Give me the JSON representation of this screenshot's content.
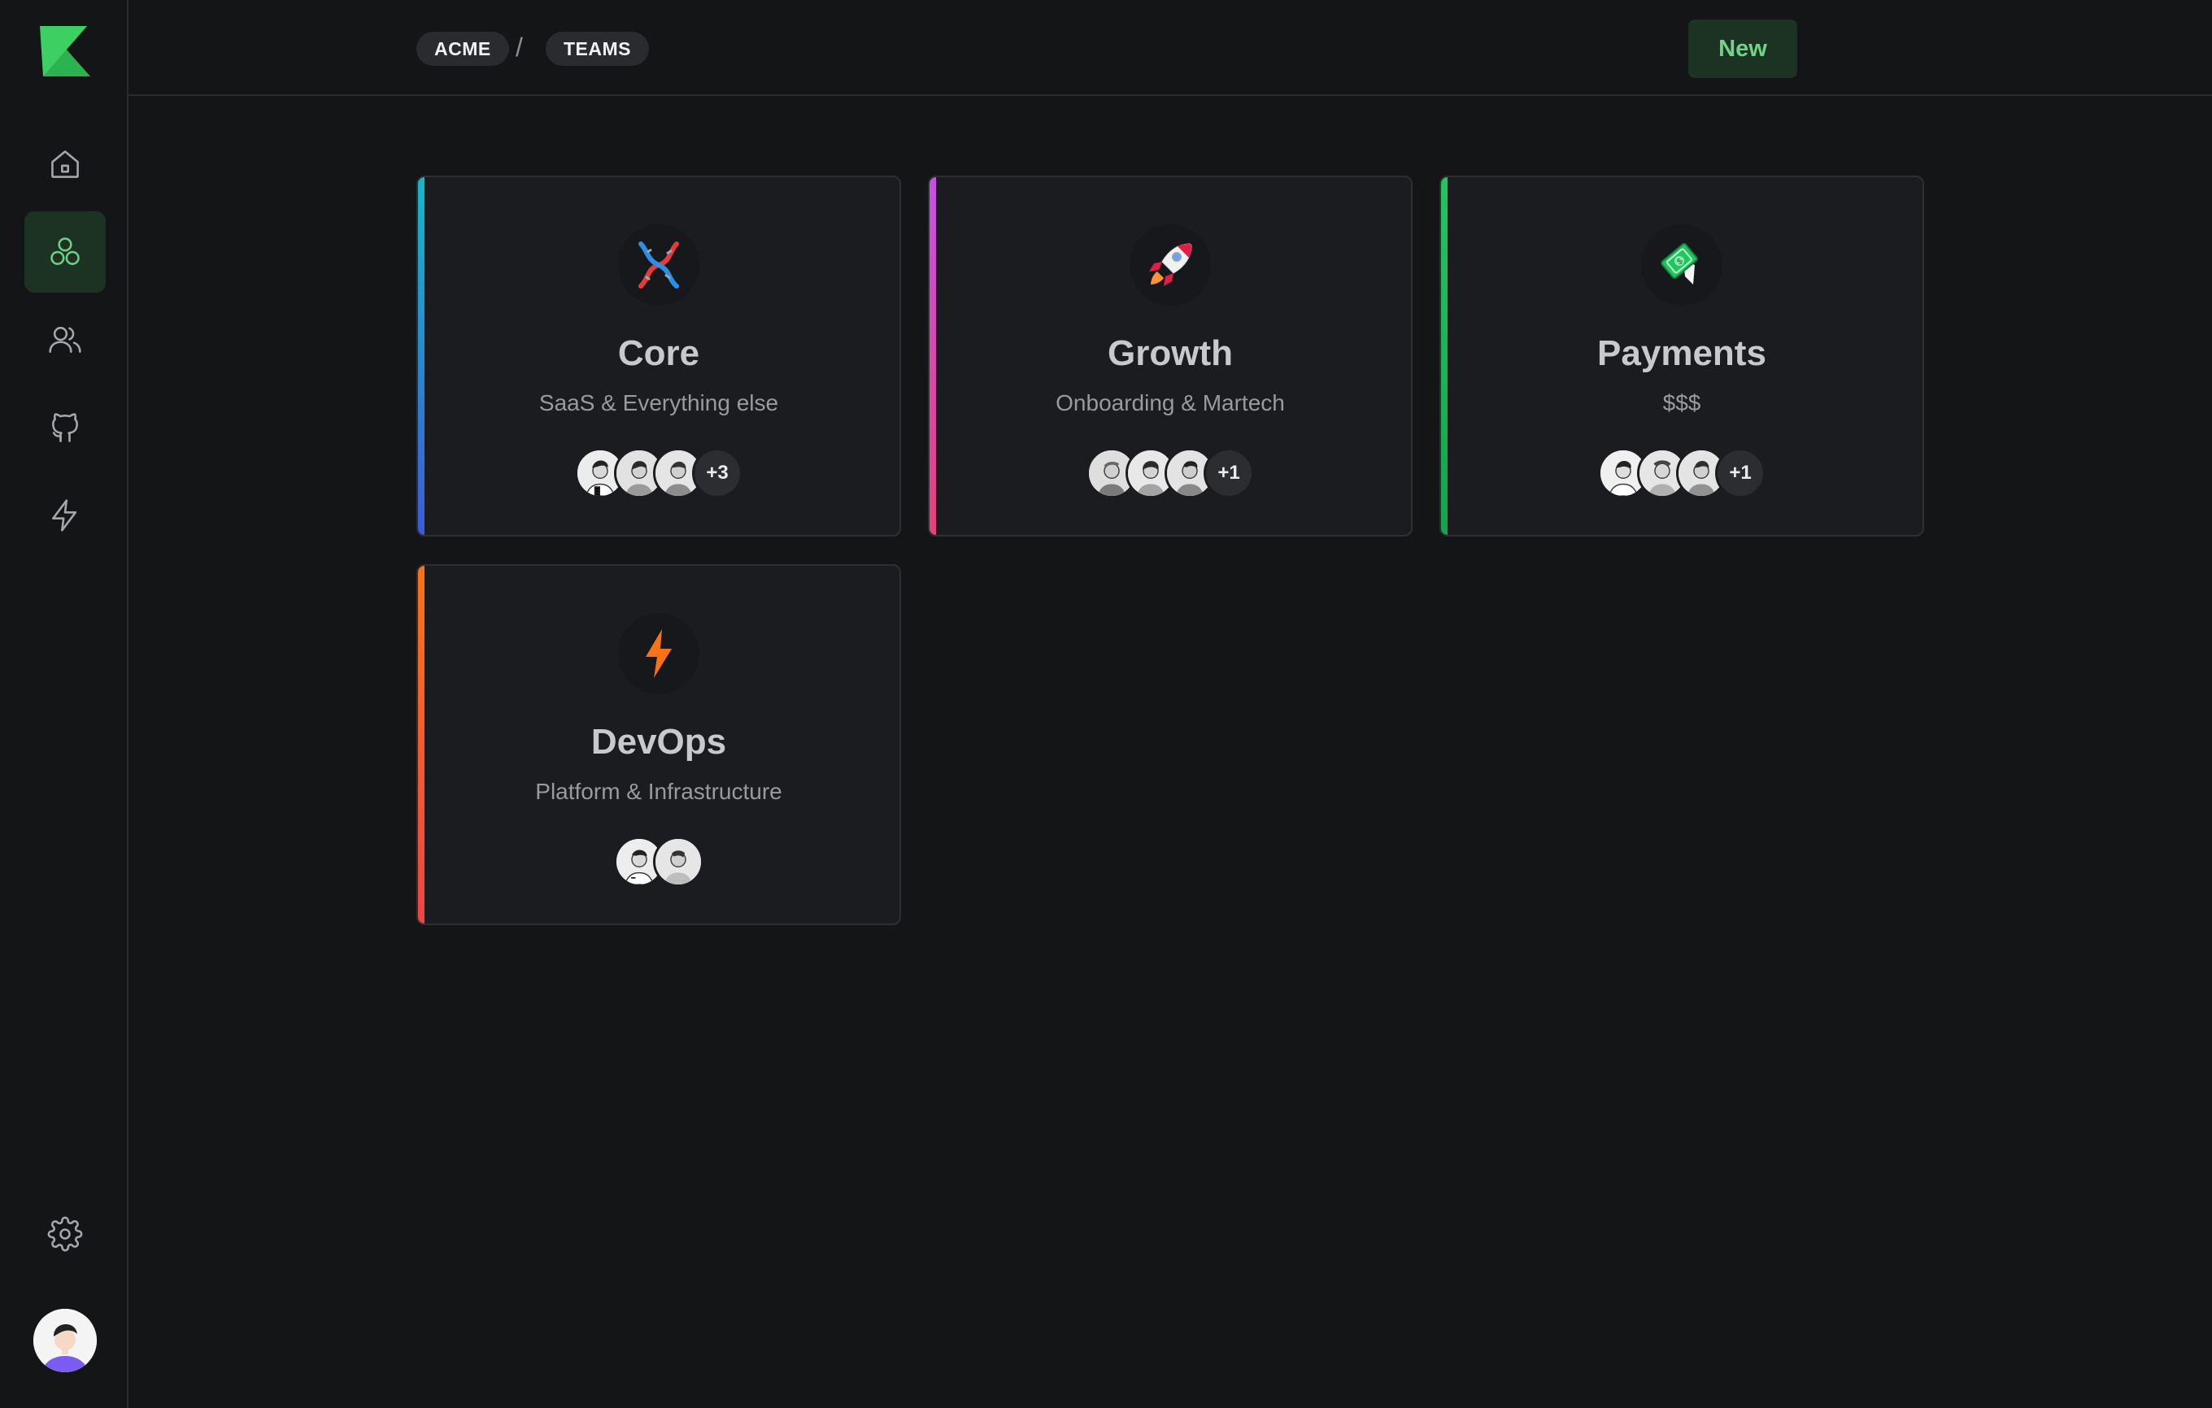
{
  "breadcrumb": {
    "org": "ACME",
    "separator": "/",
    "section": "TEAMS"
  },
  "header": {
    "new_label": "New"
  },
  "sidebar": {
    "items": [
      {
        "name": "home",
        "icon": "home-icon"
      },
      {
        "name": "teams",
        "icon": "teams-icon",
        "active": true
      },
      {
        "name": "users",
        "icon": "users-icon"
      },
      {
        "name": "github",
        "icon": "github-icon"
      },
      {
        "name": "activity",
        "icon": "bolt-icon"
      },
      {
        "name": "settings",
        "icon": "gear-icon"
      }
    ]
  },
  "colors": {
    "accent": "#71d38a",
    "core_stripe": [
      "#14b8c6",
      "#3b5bdb"
    ],
    "growth_stripe": [
      "#c850e8",
      "#e8407a"
    ],
    "payments_stripe": [
      "#22c55e",
      "#16a34a"
    ],
    "devops_stripe": [
      "#f97316",
      "#ef4444"
    ]
  },
  "teams": [
    {
      "title": "Core",
      "subtitle": "SaaS & Everything else",
      "emoji": "dna-icon",
      "more": "+3",
      "members": 3
    },
    {
      "title": "Growth",
      "subtitle": "Onboarding & Martech",
      "emoji": "rocket-icon",
      "more": "+1",
      "members": 3
    },
    {
      "title": "Payments",
      "subtitle": "$$$",
      "emoji": "money-icon",
      "more": "+1",
      "members": 3
    },
    {
      "title": "DevOps",
      "subtitle": "Platform & Infrastructure",
      "emoji": "lightning-icon",
      "more": "",
      "members": 2
    }
  ]
}
